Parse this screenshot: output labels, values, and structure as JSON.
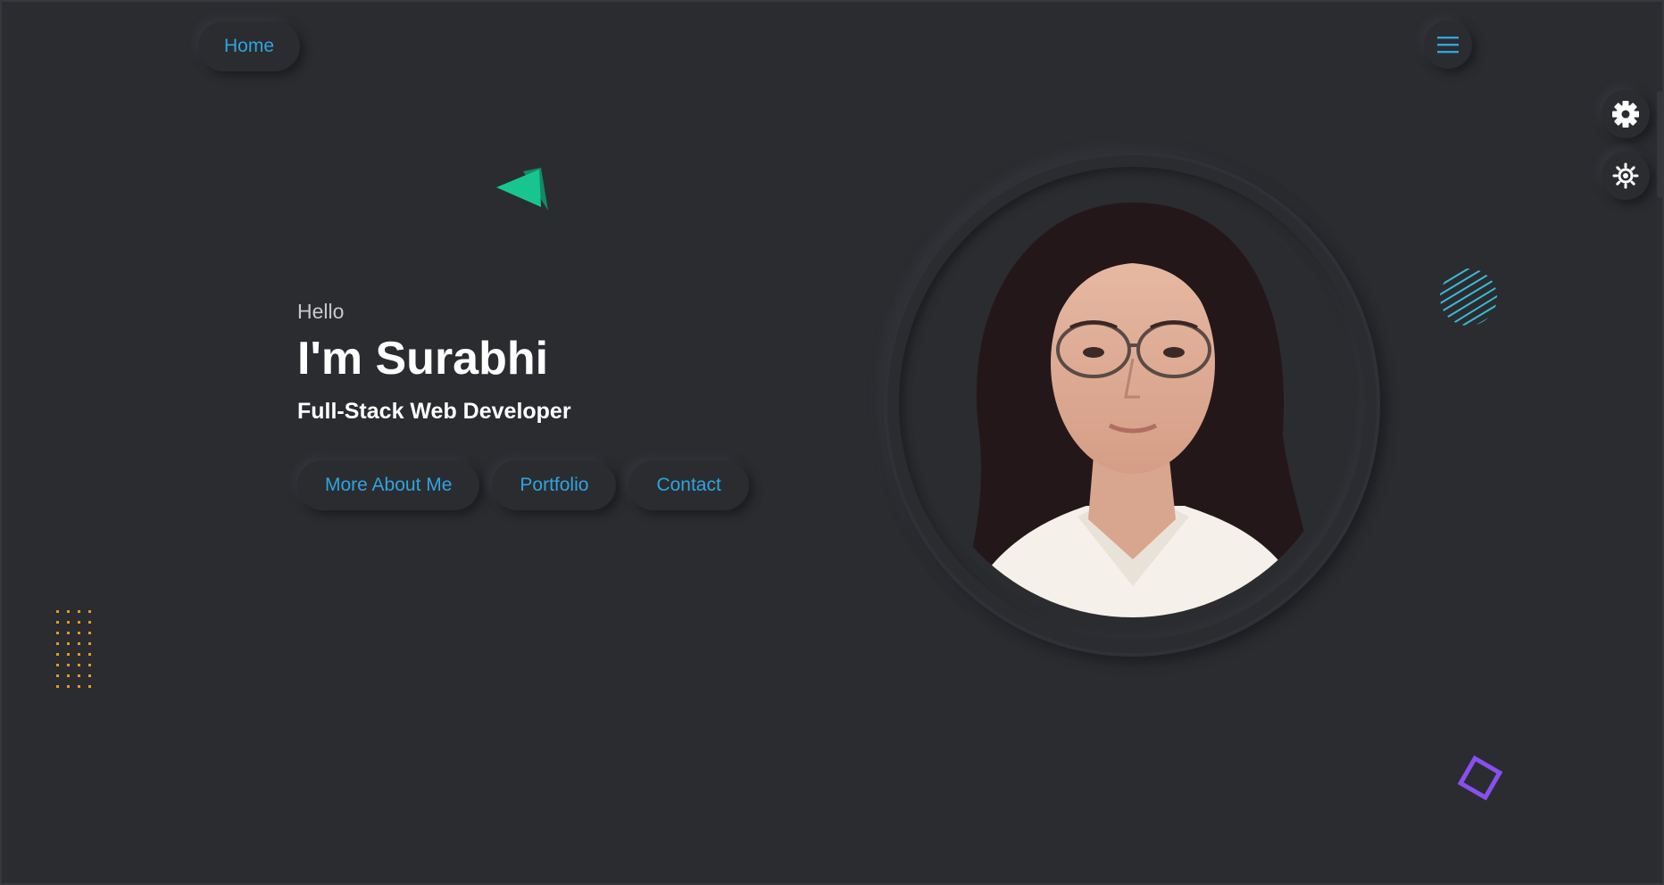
{
  "nav": {
    "home_label": "Home",
    "menu_icon": "hamburger-menu-icon"
  },
  "side_controls": {
    "settings_icon": "gear-icon",
    "theme_icon": "sun-icon"
  },
  "hero": {
    "greeting": "Hello",
    "name": "I'm Surabhi",
    "role": "Full-Stack Web Developer",
    "buttons": [
      {
        "label": "More About Me"
      },
      {
        "label": "Portfolio"
      },
      {
        "label": "Contact"
      }
    ]
  },
  "portrait": {
    "alt": "profile-photo"
  },
  "colors": {
    "background": "#2a2c30",
    "accent": "#2fa4e0",
    "triangle": "#19c58f",
    "hatch": "#3fb7d6",
    "dots": "#e89a1c",
    "diamond": "#8a4ff0"
  }
}
